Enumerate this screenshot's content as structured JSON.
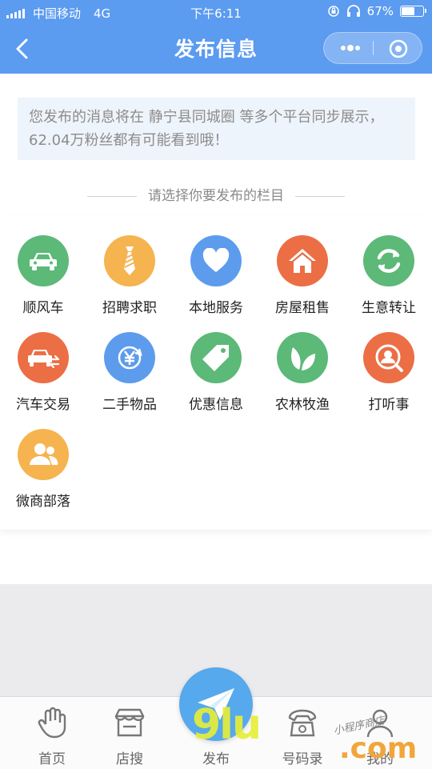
{
  "status_bar": {
    "carrier": "中国移动",
    "network": "4G",
    "time": "下午6:11",
    "battery_text": "67%",
    "battery_level": 0.67
  },
  "nav": {
    "title": "发布信息",
    "back_icon": "chevron-left-icon",
    "more_icon": "more-dots-icon",
    "close_icon": "target-icon"
  },
  "notice": {
    "text": "您发布的消息将在 静宁县同城圈 等多个平台同步展示，62.04万粉丝都有可能看到哦！"
  },
  "section_title": "请选择你要发布的栏目",
  "categories": [
    {
      "label": "顺风车",
      "icon": "car-icon",
      "color": "#5cb978"
    },
    {
      "label": "招聘求职",
      "icon": "tie-icon",
      "color": "#f5b44f"
    },
    {
      "label": "本地服务",
      "icon": "heart-icon",
      "color": "#5d9cec"
    },
    {
      "label": "房屋租售",
      "icon": "house-icon",
      "color": "#ec6e45"
    },
    {
      "label": "生意转让",
      "icon": "refresh-icon",
      "color": "#5cb978"
    },
    {
      "label": "汽车交易",
      "icon": "car-exchange-icon",
      "color": "#ec6e45"
    },
    {
      "label": "二手物品",
      "icon": "yen-cycle-icon",
      "color": "#5d9cec"
    },
    {
      "label": "优惠信息",
      "icon": "tag-icon",
      "color": "#5cb978"
    },
    {
      "label": "农林牧渔",
      "icon": "leaf-icon",
      "color": "#5cb978"
    },
    {
      "label": "打听事",
      "icon": "person-search-icon",
      "color": "#ec6e45"
    },
    {
      "label": "微商部落",
      "icon": "group-icon",
      "color": "#f5b44f"
    }
  ],
  "tabs": [
    {
      "label": "首页",
      "icon": "hand-icon"
    },
    {
      "label": "店搜",
      "icon": "shop-icon"
    },
    {
      "label": "发布",
      "icon": "paper-plane-icon"
    },
    {
      "label": "号码录",
      "icon": "phone-icon"
    },
    {
      "label": "我的",
      "icon": "user-icon"
    }
  ],
  "watermark": {
    "logo": "9lu",
    "domain": ".com",
    "tag": "小程序商店"
  }
}
